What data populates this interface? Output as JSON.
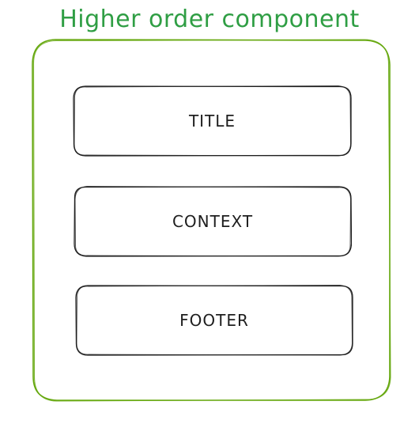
{
  "diagram": {
    "title": "Higher order component",
    "container_color": "#66a80f",
    "title_color": "#2f9e44",
    "box_stroke_color": "#1e1e1e",
    "boxes": [
      {
        "label": "TITLE"
      },
      {
        "label": "CONTEXT"
      },
      {
        "label": "FOOTER"
      }
    ]
  }
}
